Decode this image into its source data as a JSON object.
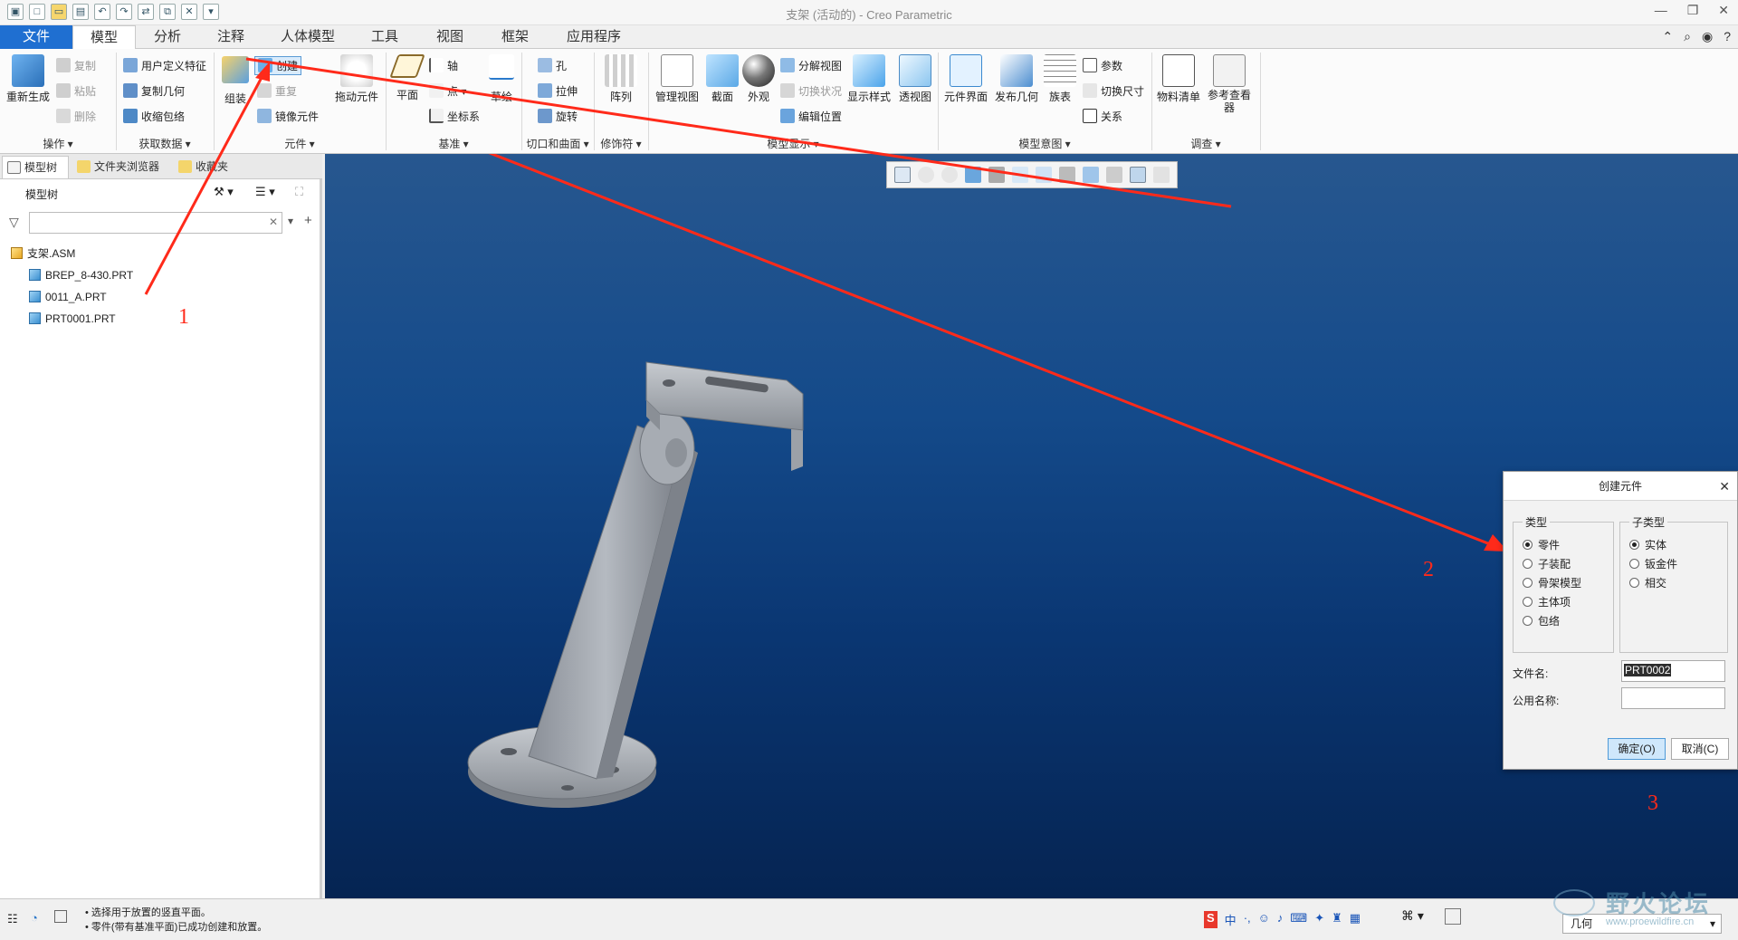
{
  "window": {
    "title": "支架 (活动的) - Creo Parametric"
  },
  "tabs": [
    {
      "label": "文件"
    },
    {
      "label": "模型"
    },
    {
      "label": "分析"
    },
    {
      "label": "注释"
    },
    {
      "label": "人体模型"
    },
    {
      "label": "工具"
    },
    {
      "label": "视图"
    },
    {
      "label": "框架"
    },
    {
      "label": "应用程序"
    }
  ],
  "ribbon": {
    "regen": "重新生成",
    "copy": "复制",
    "paste": "粘贴",
    "delete": "删除",
    "udf": "用户定义特征",
    "copy_geom": "复制几何",
    "shrinkwrap": "收缩包络",
    "assemble": "组装",
    "create": "创建",
    "repeat": "重复",
    "mirror_comp": "镜像元件",
    "drag": "拖动元件",
    "plane": "平面",
    "axis": "轴",
    "point": "点",
    "csys": "坐标系",
    "sketch": "草绘",
    "hole": "孔",
    "extrude": "拉伸",
    "revolve": "旋转",
    "pattern": "阵列",
    "manage_views": "管理视图",
    "section": "截面",
    "appearance": "外观",
    "explode_view": "分解视图",
    "toggle_state": "切换状况",
    "edit_position": "编辑位置",
    "display_style": "显示样式",
    "perspective": "透视图",
    "comp_interface": "元件界面",
    "publish_geom": "发布几何",
    "family_table": "族表",
    "params": "参数",
    "switch_dims": "切换尺寸",
    "relations": "关系",
    "bom": "物料清单",
    "ref_viewer": "参考查看器",
    "groups": {
      "operations": "操作",
      "get_data": "获取数据",
      "components": "元件",
      "datum": "基准",
      "cut_surface": "切口和曲面",
      "modifiers": "修饰符",
      "model_display": "模型显示",
      "model_intent": "模型意图",
      "investigate": "调查"
    }
  },
  "left_panel": {
    "tabs": [
      {
        "label": "模型树"
      },
      {
        "label": "文件夹浏览器"
      },
      {
        "label": "收藏夹"
      }
    ],
    "tree_title": "模型树",
    "tree": [
      {
        "label": "支架.ASM"
      },
      {
        "label": "BREP_8-430.PRT"
      },
      {
        "label": "0011_A.PRT"
      },
      {
        "label": "PRT0001.PRT"
      }
    ]
  },
  "dialog": {
    "title": "创建元件",
    "type_label": "类型",
    "subtype_label": "子类型",
    "types": [
      {
        "label": "零件",
        "selected": true
      },
      {
        "label": "子装配",
        "selected": false
      },
      {
        "label": "骨架模型",
        "selected": false
      },
      {
        "label": "主体项",
        "selected": false
      },
      {
        "label": "包络",
        "selected": false
      }
    ],
    "subtypes": [
      {
        "label": "实体",
        "selected": true
      },
      {
        "label": "钣金件",
        "selected": false
      },
      {
        "label": "相交",
        "selected": false
      }
    ],
    "filename_label": "文件名:",
    "filename_value": "PRT0002",
    "common_name_label": "公用名称:",
    "common_name_value": "",
    "ok_label": "确定(O)",
    "cancel_label": "取消(C)"
  },
  "annotations": {
    "step1": "1",
    "step2": "2",
    "step3": "3",
    "arrow_color": "#ff2a1a"
  },
  "status": {
    "line1": "• 选择用于放置的竖直平面。",
    "line2": "• 零件(带有基准平面)已成功创建和放置。",
    "filter_value": "几何"
  },
  "watermark": {
    "text": "野火论坛",
    "url": "www.proewildfire.cn"
  },
  "colors": {
    "accent": "#1f6fd1",
    "viewport_top": "#27578f",
    "viewport_bottom": "#052452"
  }
}
